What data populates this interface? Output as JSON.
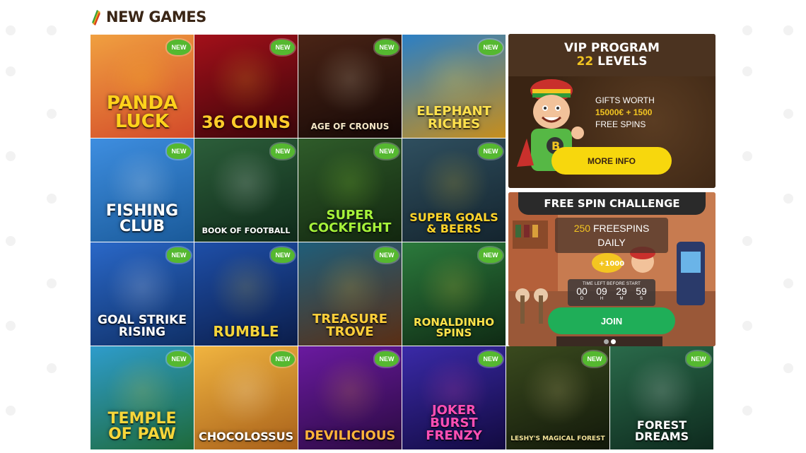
{
  "section": {
    "title": "NEW GAMES"
  },
  "badge_label": "NEW",
  "games": [
    {
      "title": "PANDA LUCK",
      "bg": "#f0a040",
      "bg2": "#d34a2a",
      "text_color": "#ffd21c",
      "font_size": 26
    },
    {
      "title": "36 COINS",
      "bg": "#a3101a",
      "bg2": "#3a0509",
      "text_color": "#ffcc2a",
      "font_size": 24
    },
    {
      "title": "AGE OF CRONUS",
      "bg": "#4a2416",
      "bg2": "#150806",
      "text_color": "#f3e5c5",
      "font_size": 12
    },
    {
      "title": "ELEPHANT RICHES",
      "bg": "#2b7fc5",
      "bg2": "#c68e1d",
      "text_color": "#ffe14d",
      "font_size": 18
    },
    {
      "title": "FISHING CLUB",
      "bg": "#3e8ee0",
      "bg2": "#1a5a9a",
      "text_color": "#ffffff",
      "font_size": 22
    },
    {
      "title": "BOOK OF FOOTBALL",
      "bg": "#2c5e3a",
      "bg2": "#0f2a1a",
      "text_color": "#ffffff",
      "font_size": 11
    },
    {
      "title": "SUPER COCKFIGHT",
      "bg": "#2f5c2a",
      "bg2": "#12260f",
      "text_color": "#a6f23a",
      "font_size": 18
    },
    {
      "title": "SUPER GOALS & BEERS",
      "bg": "#2f4f5f",
      "bg2": "#14242e",
      "text_color": "#ffd42a",
      "font_size": 16
    },
    {
      "title": "GOAL STRIKE RISING",
      "bg": "#2a68c8",
      "bg2": "#0f2f66",
      "text_color": "#ffffff",
      "font_size": 17
    },
    {
      "title": "RUMBLE",
      "bg": "#1e4fa8",
      "bg2": "#0b1d4a",
      "text_color": "#f5d43a",
      "font_size": 20
    },
    {
      "title": "TREASURE TROVE",
      "bg": "#1f5e7a",
      "bg2": "#5a2e14",
      "text_color": "#ffcf3a",
      "font_size": 18
    },
    {
      "title": "RONALDINHO SPINS",
      "bg": "#2b7a3c",
      "bg2": "#0f2a14",
      "text_color": "#ffe24a",
      "font_size": 15
    },
    {
      "title": "TEMPLE OF PAW",
      "bg": "#2e9ccc",
      "bg2": "#1e6a3a",
      "text_color": "#f7d63a",
      "font_size": 22
    },
    {
      "title": "CHOCOLOSSUS",
      "bg": "#f0b440",
      "bg2": "#a8601a",
      "text_color": "#ffffff",
      "font_size": 16
    },
    {
      "title": "DEVILICIOUS",
      "bg": "#6a1aa0",
      "bg2": "#2a0a40",
      "text_color": "#ffb43a",
      "font_size": 18
    },
    {
      "title": "JOKER BURST FRENZY",
      "bg": "#3a2aa8",
      "bg2": "#120a40",
      "text_color": "#ff4fb4",
      "font_size": 18
    },
    {
      "title": "LESHY'S MAGICAL FOREST",
      "bg": "#3a4a1e",
      "bg2": "#12180a",
      "text_color": "#f4e49a",
      "font_size": 9
    },
    {
      "title": "FOREST DREAMS",
      "bg": "#2a6a4a",
      "bg2": "#0e2a1e",
      "text_color": "#ffffff",
      "font_size": 16
    }
  ],
  "vip": {
    "title": "VIP PROGRAM",
    "levels_num": "22",
    "levels_word": "LEVELS",
    "line1": "GIFTS WORTH",
    "amount": "15000€ + 1500",
    "line3": "FREE SPINS",
    "button": "MORE INFO"
  },
  "challenge": {
    "title": "FREE SPIN CHALLENGE",
    "freespins_num": "250",
    "freespins_word": "FREESPINS",
    "daily": "DAILY",
    "timer_label": "TIME LEFT BEFORE START",
    "timer": [
      {
        "value": "00",
        "unit": "D"
      },
      {
        "value": "09",
        "unit": "H"
      },
      {
        "value": "29",
        "unit": "M"
      },
      {
        "value": "59",
        "unit": "S"
      }
    ],
    "button": "JOIN"
  },
  "carousel": {
    "count": 2,
    "active": 1
  },
  "colors": {
    "badge": "#55b830",
    "vip_button": "#f7d70d",
    "join_button": "#1fae58",
    "accent_yellow": "#f3c521"
  }
}
